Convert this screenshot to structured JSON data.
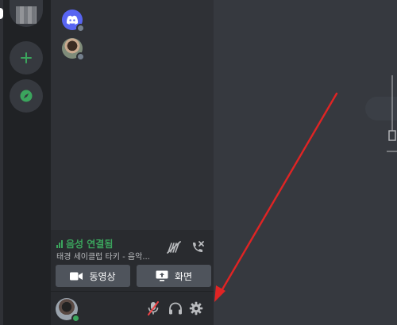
{
  "servers": {
    "add_icon": "plus-icon",
    "explore_icon": "compass-icon",
    "accent": "#3ba55d"
  },
  "members": [
    {
      "avatar": "discord-logo-avatar",
      "status": "offline"
    },
    {
      "avatar": "photo-avatar",
      "status": "offline"
    }
  ],
  "voice": {
    "status": "음성 연결됨",
    "channel": "태경 세이클럽 타키 - 음악...",
    "status_color": "#3ba55d",
    "video_label": "동영상",
    "screen_label": "화면"
  },
  "user": {
    "status": "online",
    "mute_icon": "microphone-muted-icon",
    "deafen_icon": "headphones-icon",
    "settings_icon": "gear-icon"
  },
  "annotation": {
    "arrow_color": "#e02424"
  }
}
